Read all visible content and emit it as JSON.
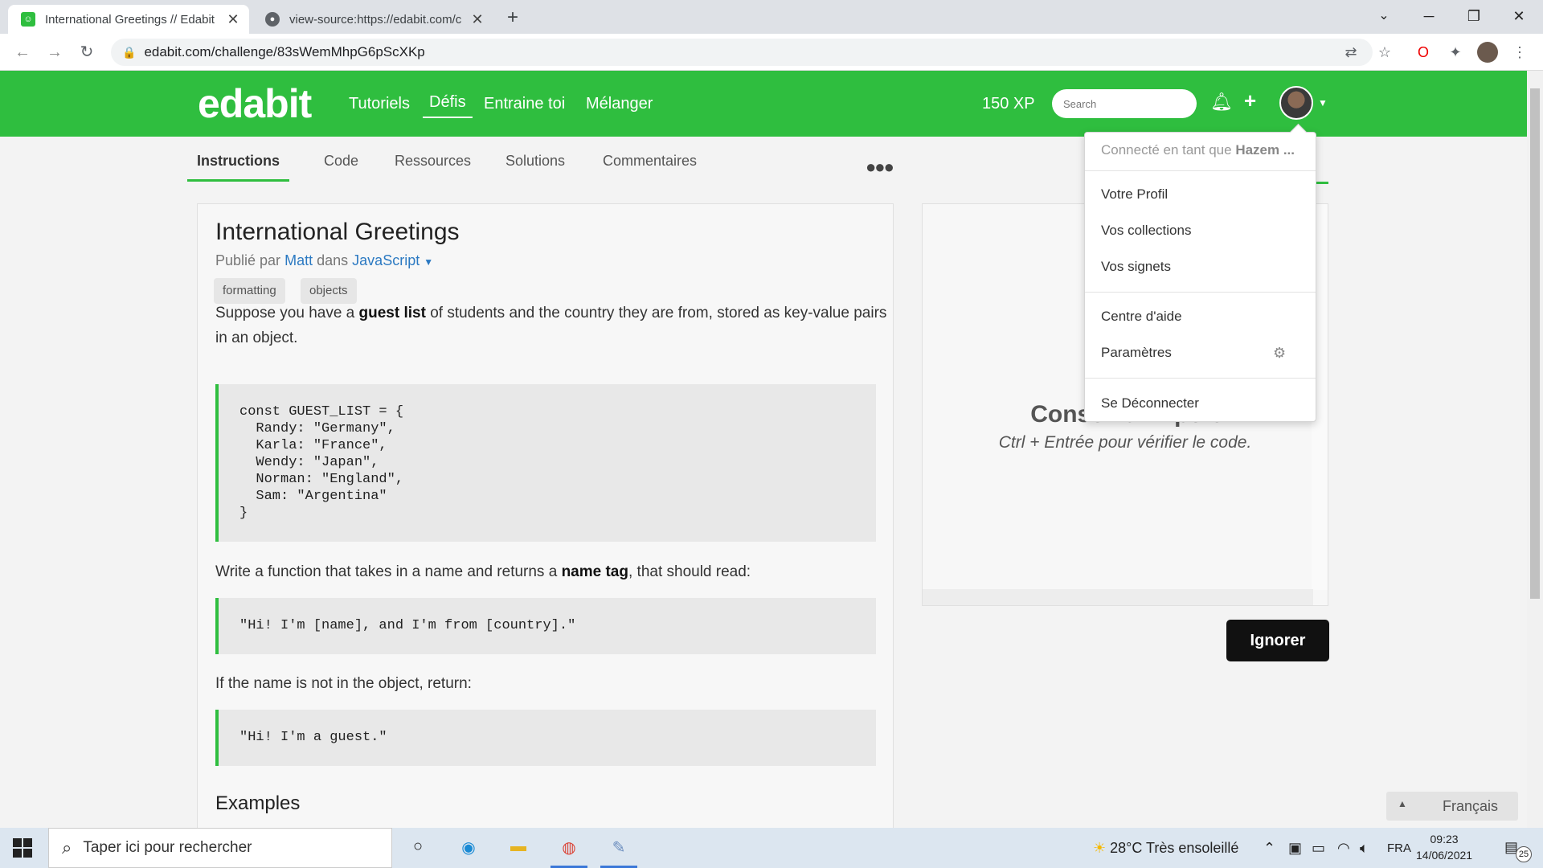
{
  "browser": {
    "tabs": [
      {
        "title": "International Greetings // Edabit",
        "active": true
      },
      {
        "title": "view-source:https://edabit.com/c",
        "active": false
      }
    ],
    "url": "edabit.com/challenge/83sWemMhpG6pScXKp",
    "tab_close": "✕",
    "new_tab": "+"
  },
  "header": {
    "logo": "edabit",
    "nav": [
      "Tutoriels",
      "Défis",
      "Entraine toi",
      "Mélanger"
    ],
    "active_nav": "Défis",
    "xp": "150 XP",
    "search_placeholder": "Search"
  },
  "subtabs": [
    "Instructions",
    "Code",
    "Ressources",
    "Solutions",
    "Commentaires"
  ],
  "challenge": {
    "title": "International Greetings",
    "by_prefix": "Publié par",
    "author": "Matt",
    "in_word": "dans",
    "language": "JavaScript",
    "tags": [
      "formatting",
      "objects"
    ],
    "p1_a": "Suppose you have a ",
    "p1_b": "guest list",
    "p1_c": " of students and the country they are from, stored as key-value pairs in an object.",
    "code1": "const GUEST_LIST = {\n  Randy: \"Germany\",\n  Karla: \"France\",\n  Wendy: \"Japan\",\n  Norman: \"England\",\n  Sam: \"Argentina\"\n}",
    "p2_a": "Write a function that takes in a name and returns a ",
    "p2_b": "name tag",
    "p2_c": ", that should read:",
    "code2": "\"Hi! I'm [name], and I'm from [country].\"",
    "p3": "If the name is not in the object, return:",
    "code3": "\"Hi! I'm a guest.\"",
    "examples_heading": "Examples"
  },
  "right_panel": {
    "title": "Conseil d'Expert",
    "subtitle": "Ctrl + Entrée pour vérifier le code.",
    "ignore_button": "Ignorer"
  },
  "dropdown": {
    "connected_prefix": "Connecté en tant que",
    "user": "Hazem ...",
    "items": [
      "Votre Profil",
      "Vos collections",
      "Vos signets",
      "Centre d'aide",
      "Paramètres",
      "Se Déconnecter"
    ]
  },
  "language_selector": "Français",
  "taskbar": {
    "search_placeholder": "Taper ici pour rechercher",
    "weather": "28°C  Très ensoleillé",
    "lang": "FRA",
    "time": "09:23",
    "date": "14/06/2021",
    "notifications": "25"
  }
}
